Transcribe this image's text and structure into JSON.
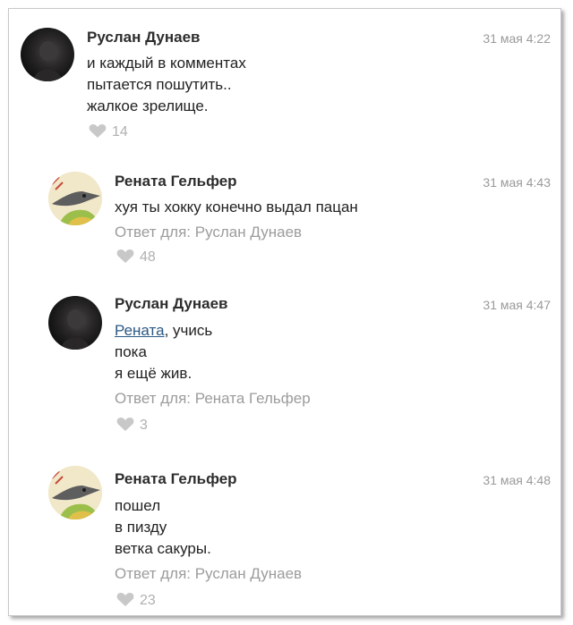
{
  "comments": [
    {
      "author": "Руслан Дунаев",
      "time": "31 мая 4:22",
      "lines": [
        "и каждый в комментах",
        "пытается пошутить..",
        "жалкое зрелище."
      ],
      "likes": "14"
    },
    {
      "author": "Рената Гельфер",
      "time": "31 мая 4:43",
      "lines": [
        "хуя ты хокку конечно выдал пацан"
      ],
      "reply": "Ответ для: Руслан Дунаев",
      "likes": "48"
    },
    {
      "author": "Руслан Дунаев",
      "time": "31 мая 4:47",
      "mention": "Рената",
      "lines": [
        ", учись",
        "пока",
        "я ещё жив."
      ],
      "reply": "Ответ для: Рената Гельфер",
      "likes": "3"
    },
    {
      "author": "Рената Гельфер",
      "time": "31 мая 4:48",
      "lines": [
        "пошел",
        "в пизду",
        "ветка сакуры."
      ],
      "reply": "Ответ для: Руслан Дунаев",
      "likes": "23"
    }
  ],
  "icons": {
    "avatar_ruslan": "dark-photo",
    "avatar_renata": "bird-illustration",
    "like": "heart-icon"
  },
  "colors": {
    "mention": "#2a5885",
    "meta": "#9c9c9c",
    "like": "#c8c8c8"
  }
}
